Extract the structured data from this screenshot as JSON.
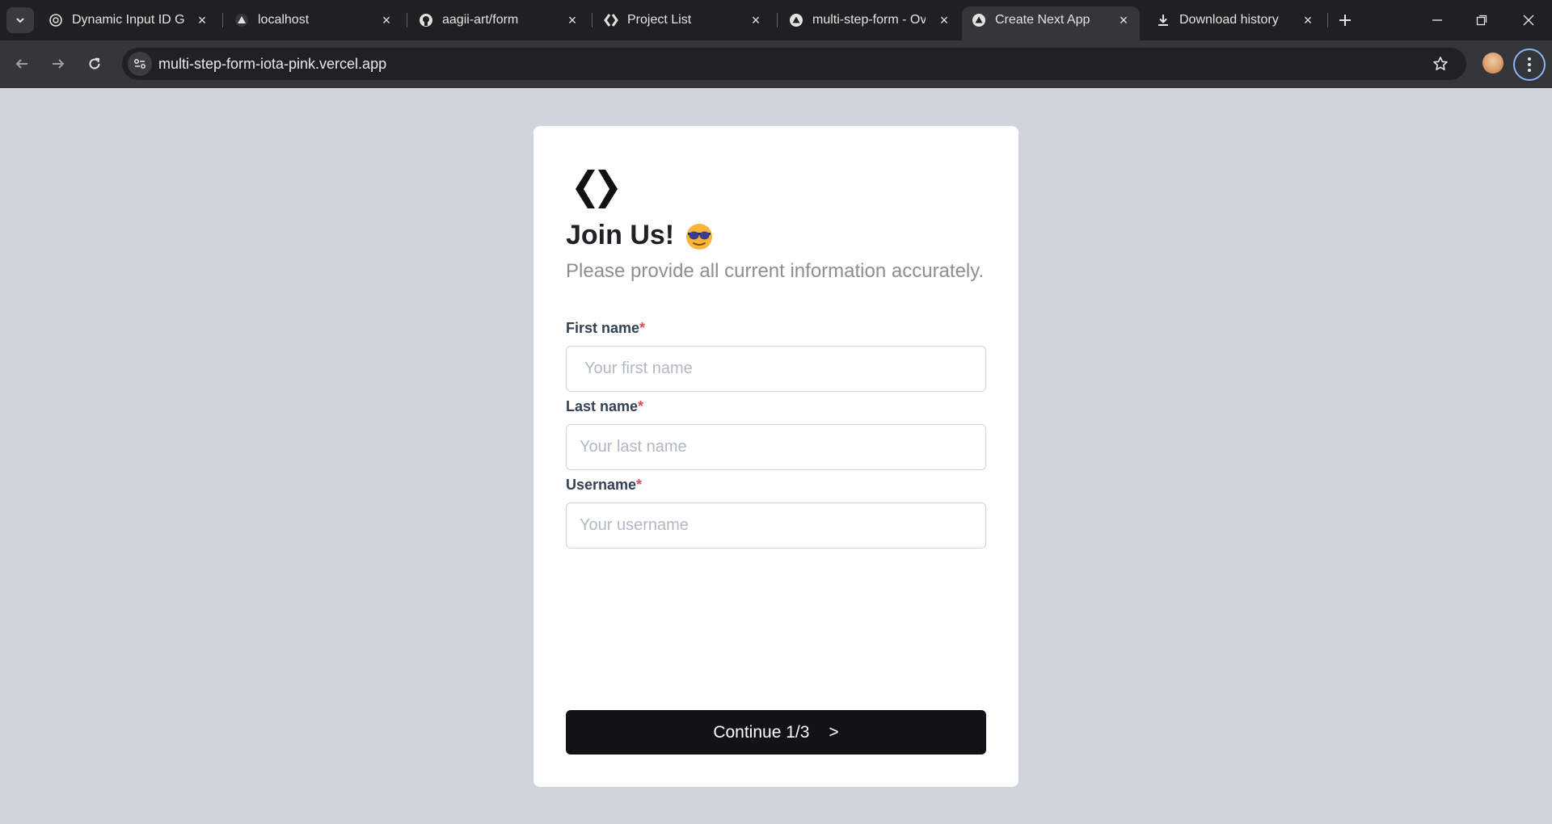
{
  "browser": {
    "tabs": [
      {
        "title": "Dynamic Input ID Ge",
        "favicon": "openai-icon"
      },
      {
        "title": "localhost",
        "favicon": "triangle-icon"
      },
      {
        "title": "aagii-art/form",
        "favicon": "github-icon"
      },
      {
        "title": "Project List",
        "favicon": "brackets-logo-icon"
      },
      {
        "title": "multi-step-form - Ov",
        "favicon": "vercel-icon"
      },
      {
        "title": "Create Next App",
        "favicon": "vercel-icon",
        "active": true
      },
      {
        "title": "Download history",
        "favicon": "download-icon"
      }
    ],
    "url": "multi-step-form-iota-pink.vercel.app"
  },
  "form": {
    "title": "Join Us!",
    "subtitle": "Please provide all current information accurately.",
    "required_mark": "*",
    "fields": [
      {
        "label": "First name",
        "placeholder": "Your first name",
        "value": ""
      },
      {
        "label": "Last name",
        "placeholder": "Your last name",
        "value": ""
      },
      {
        "label": "Username",
        "placeholder": "Your username",
        "value": ""
      }
    ],
    "continue_label": "Continue 1/3",
    "continue_arrow": ">"
  },
  "colors": {
    "page_bg": "#d0d5dd",
    "card_bg": "#ffffff",
    "button_bg": "#121316",
    "required": "#e14a55",
    "chrome_dark": "#1f2022",
    "chrome_toolbar": "#35363a"
  }
}
